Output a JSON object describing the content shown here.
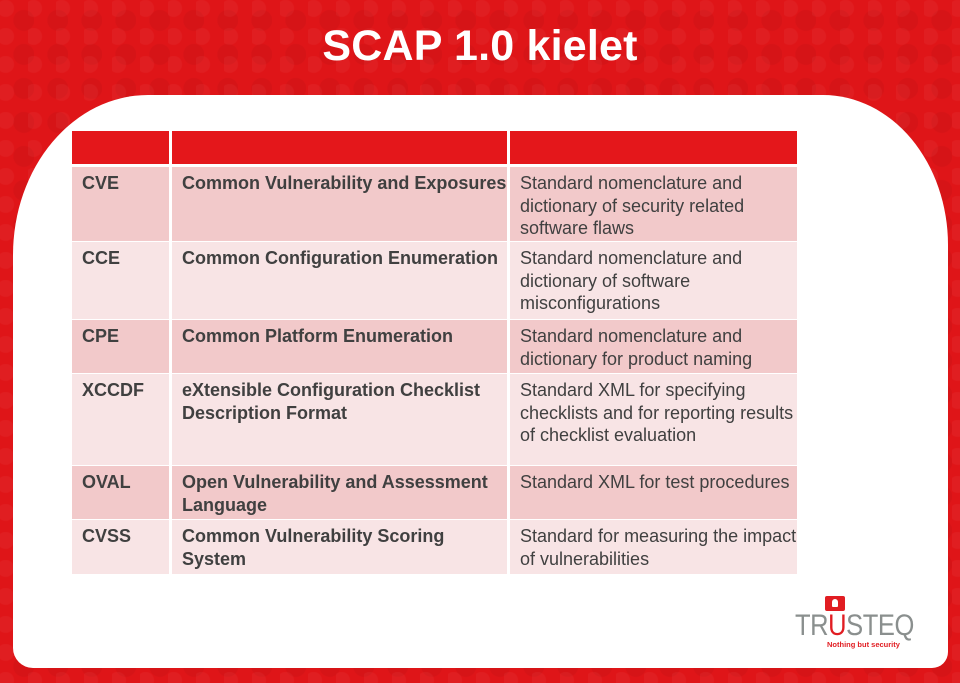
{
  "slide": {
    "title": "SCAP 1.0 kielet"
  },
  "table": {
    "headers": [
      "",
      "",
      ""
    ],
    "rows": [
      {
        "abbr": "CVE",
        "name": "Common Vulnerability and Exposures",
        "description": "Standard nomenclature and dictionary of security related software flaws"
      },
      {
        "abbr": "CCE",
        "name": "Common Configuration Enumeration",
        "description": "Standard nomenclature and dictionary of software misconfigurations"
      },
      {
        "abbr": "CPE",
        "name": "Common Platform Enumeration",
        "description": "Standard nomenclature and dictionary for product naming"
      },
      {
        "abbr": "XCCDF",
        "name": "eXtensible Configuration Checklist Description Format",
        "description": "Standard XML for specifying checklists and for reporting results of checklist evaluation"
      },
      {
        "abbr": "OVAL",
        "name": "Open Vulnerability and Assessment Language",
        "description": "Standard XML for test procedures"
      },
      {
        "abbr": "CVSS",
        "name": "Common Vulnerability Scoring System",
        "description": "Standard for measuring the impact of vulnerabilities"
      }
    ]
  },
  "logo": {
    "brand_prefix": "TR",
    "brand_highlight": "U",
    "brand_suffix": "STEQ",
    "tagline": "Nothing but security",
    "icon": "lock-icon"
  },
  "colors": {
    "brand_red": "#e4171b",
    "row_dark": "#f2c9ca",
    "row_light": "#f8e4e5",
    "text": "#404040",
    "logo_gray": "#8a8f8e"
  }
}
